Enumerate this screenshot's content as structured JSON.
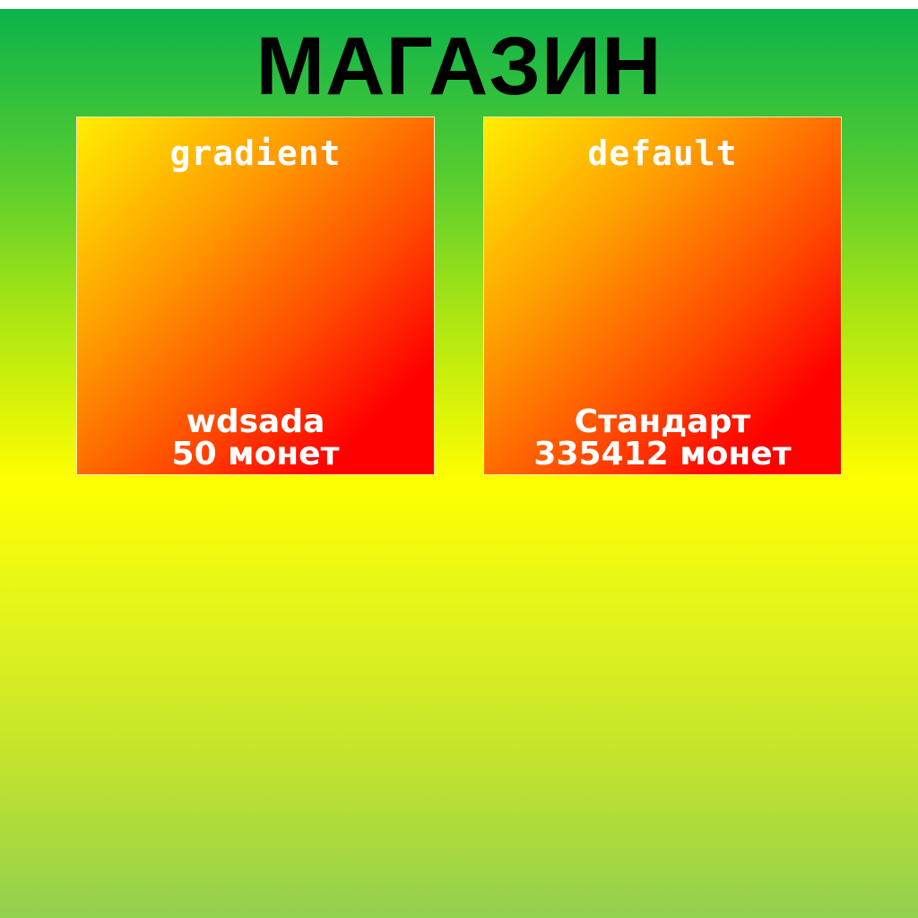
{
  "header": {
    "title": "МАГАЗИН"
  },
  "shop": {
    "items": [
      {
        "name": "gradient",
        "label": "wdsada",
        "price": "50 монет"
      },
      {
        "name": "default",
        "label": "Стандарт",
        "price": "335412 монет"
      }
    ]
  },
  "colors": {
    "title": "#000000",
    "card_text": "#ffffff",
    "background_top": "#0bb34b",
    "background_middle": "#ffff00",
    "background_bottom": "#92d050",
    "card_gradient_start": "#ffee00",
    "card_gradient_end": "#ff0000"
  }
}
